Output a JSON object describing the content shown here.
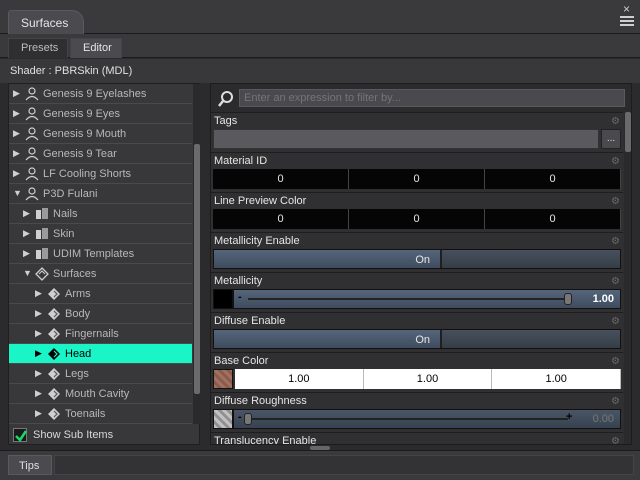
{
  "window": {
    "title": "Surfaces",
    "close_glyph": "×"
  },
  "subtabs": [
    {
      "label": "Presets",
      "active": false
    },
    {
      "label": "Editor",
      "active": true
    }
  ],
  "shader": {
    "text": "Shader :  PBRSkin (MDL)"
  },
  "tree": {
    "items": [
      {
        "label": "Genesis 9 Eyelashes",
        "expanded": false,
        "indent": 0,
        "icon": "figure-icon"
      },
      {
        "label": "Genesis 9 Eyes",
        "expanded": false,
        "indent": 0,
        "icon": "figure-icon"
      },
      {
        "label": "Genesis 9 Mouth",
        "expanded": false,
        "indent": 0,
        "icon": "figure-icon"
      },
      {
        "label": "Genesis 9 Tear",
        "expanded": false,
        "indent": 0,
        "icon": "figure-icon"
      },
      {
        "label": "LF Cooling Shorts",
        "expanded": false,
        "indent": 0,
        "icon": "figure-icon"
      },
      {
        "label": "P3D Fulani",
        "expanded": true,
        "indent": 0,
        "icon": "figure-icon"
      },
      {
        "label": "Nails",
        "expanded": false,
        "indent": 1,
        "icon": "group-icon"
      },
      {
        "label": "Skin",
        "expanded": false,
        "indent": 1,
        "icon": "group-icon"
      },
      {
        "label": "UDIM Templates",
        "expanded": false,
        "indent": 1,
        "icon": "group-icon"
      },
      {
        "label": "Surfaces",
        "expanded": true,
        "indent": 1,
        "icon": "surfaces-icon"
      },
      {
        "label": "Arms",
        "expanded": false,
        "indent": 2,
        "icon": "surface-icon"
      },
      {
        "label": "Body",
        "expanded": false,
        "indent": 2,
        "icon": "surface-icon"
      },
      {
        "label": "Fingernails",
        "expanded": false,
        "indent": 2,
        "icon": "surface-icon"
      },
      {
        "label": "Head",
        "expanded": false,
        "indent": 2,
        "icon": "surface-icon",
        "selected": true
      },
      {
        "label": "Legs",
        "expanded": false,
        "indent": 2,
        "icon": "surface-icon"
      },
      {
        "label": "Mouth Cavity",
        "expanded": false,
        "indent": 2,
        "icon": "surface-icon"
      },
      {
        "label": "Toenails",
        "expanded": false,
        "indent": 2,
        "icon": "surface-icon"
      }
    ],
    "show_sub_items": {
      "label": "Show Sub Items",
      "checked": true
    }
  },
  "filter": {
    "placeholder": "Enter an expression to filter by..."
  },
  "properties": {
    "tags": {
      "title": "Tags",
      "button": "..."
    },
    "material_id": {
      "title": "Material ID",
      "values": [
        "0",
        "0",
        "0"
      ]
    },
    "line_preview_color": {
      "title": "Line Preview Color",
      "values": [
        "0",
        "0",
        "0"
      ]
    },
    "metallicity_enable": {
      "title": "Metallicity Enable",
      "state": "On"
    },
    "metallicity": {
      "title": "Metallicity",
      "value": "1.00",
      "fraction": 1.0,
      "swatch": "#000000"
    },
    "diffuse_enable": {
      "title": "Diffuse Enable",
      "state": "On"
    },
    "base_color": {
      "title": "Base Color",
      "values": [
        "1.00",
        "1.00",
        "1.00"
      ],
      "swatch": "#a07060"
    },
    "diffuse_roughness": {
      "title": "Diffuse Roughness",
      "value": "0.00",
      "fraction": 0.0,
      "swatch": "#b0b0b0"
    },
    "translucency_enable": {
      "title": "Translucency Enable"
    }
  },
  "bottom": {
    "tab": "Tips"
  },
  "colors": {
    "selected_highlight": "#19f5c7",
    "slider_blue": "#55657a"
  }
}
